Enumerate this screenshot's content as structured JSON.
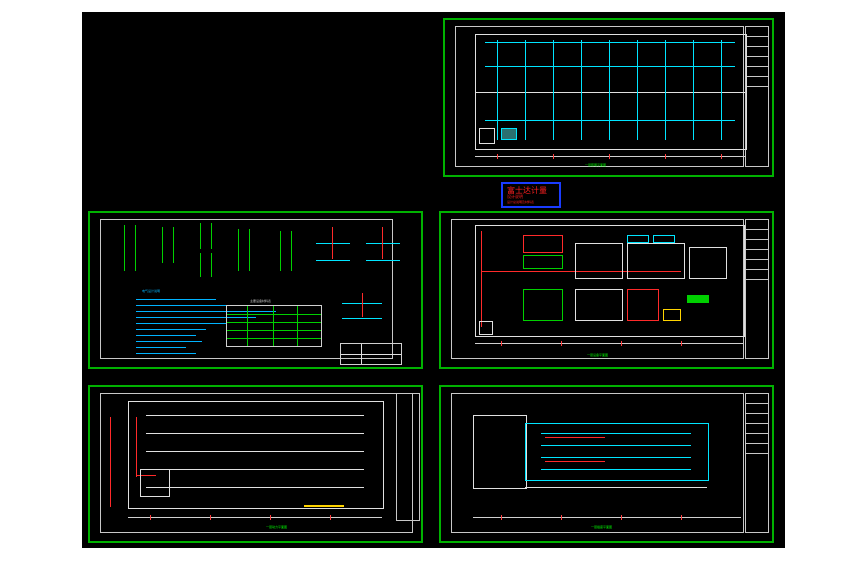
{
  "drawing": {
    "title_block": {
      "line1": "富士达计量",
      "line2": "设计说明",
      "line3": "设计总说明及材料表"
    },
    "sheets": [
      {
        "id": "sheet-plan-lighting",
        "label": "一层照明平面图"
      },
      {
        "id": "sheet-design-notes",
        "label": "设计说明"
      },
      {
        "id": "sheet-plan-equipment",
        "label": "一层设备平面图"
      },
      {
        "id": "sheet-plan-power",
        "label": "一层动力平面图"
      },
      {
        "id": "sheet-plan-socket",
        "label": "一层插座平面图"
      }
    ],
    "notes_heading": "电气设计说明",
    "table_title": "主要设备材料表"
  },
  "colors": {
    "background": "#000000",
    "frame": "#00b200",
    "cyan": "#00e5ff",
    "red": "#ff2a2a",
    "title_border": "#1a3cff"
  }
}
